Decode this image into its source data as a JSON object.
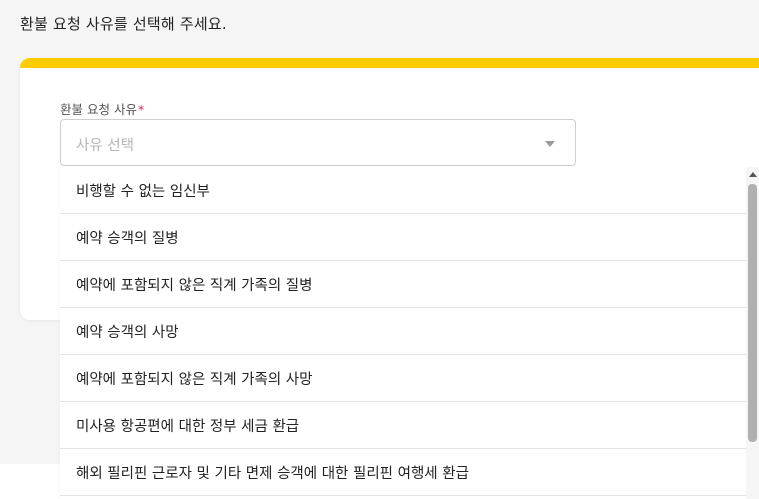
{
  "page": {
    "instruction": "환불 요청 사유를 선택해 주세요."
  },
  "form": {
    "label": "환불 요청 사유",
    "required_mark": "*",
    "select_placeholder": "사유 선택",
    "accent_color": "#ffcc00"
  },
  "dropdown": {
    "options": [
      "비행할 수 없는 임신부",
      "예약 승객의 질병",
      "예약에 포함되지 않은 직계 가족의 질병",
      "예약 승객의 사망",
      "예약에 포함되지 않은 직계 가족의 사망",
      "미사용 항공편에 대한 정부 세금 환급",
      "해외 필리핀 근로자 및 기타 면제 승객에 대한 필리핀 여행세 환급"
    ]
  },
  "icons": {
    "select_arrow": "chevron-down-icon",
    "scroll_up": "scroll-up-arrow-icon"
  }
}
